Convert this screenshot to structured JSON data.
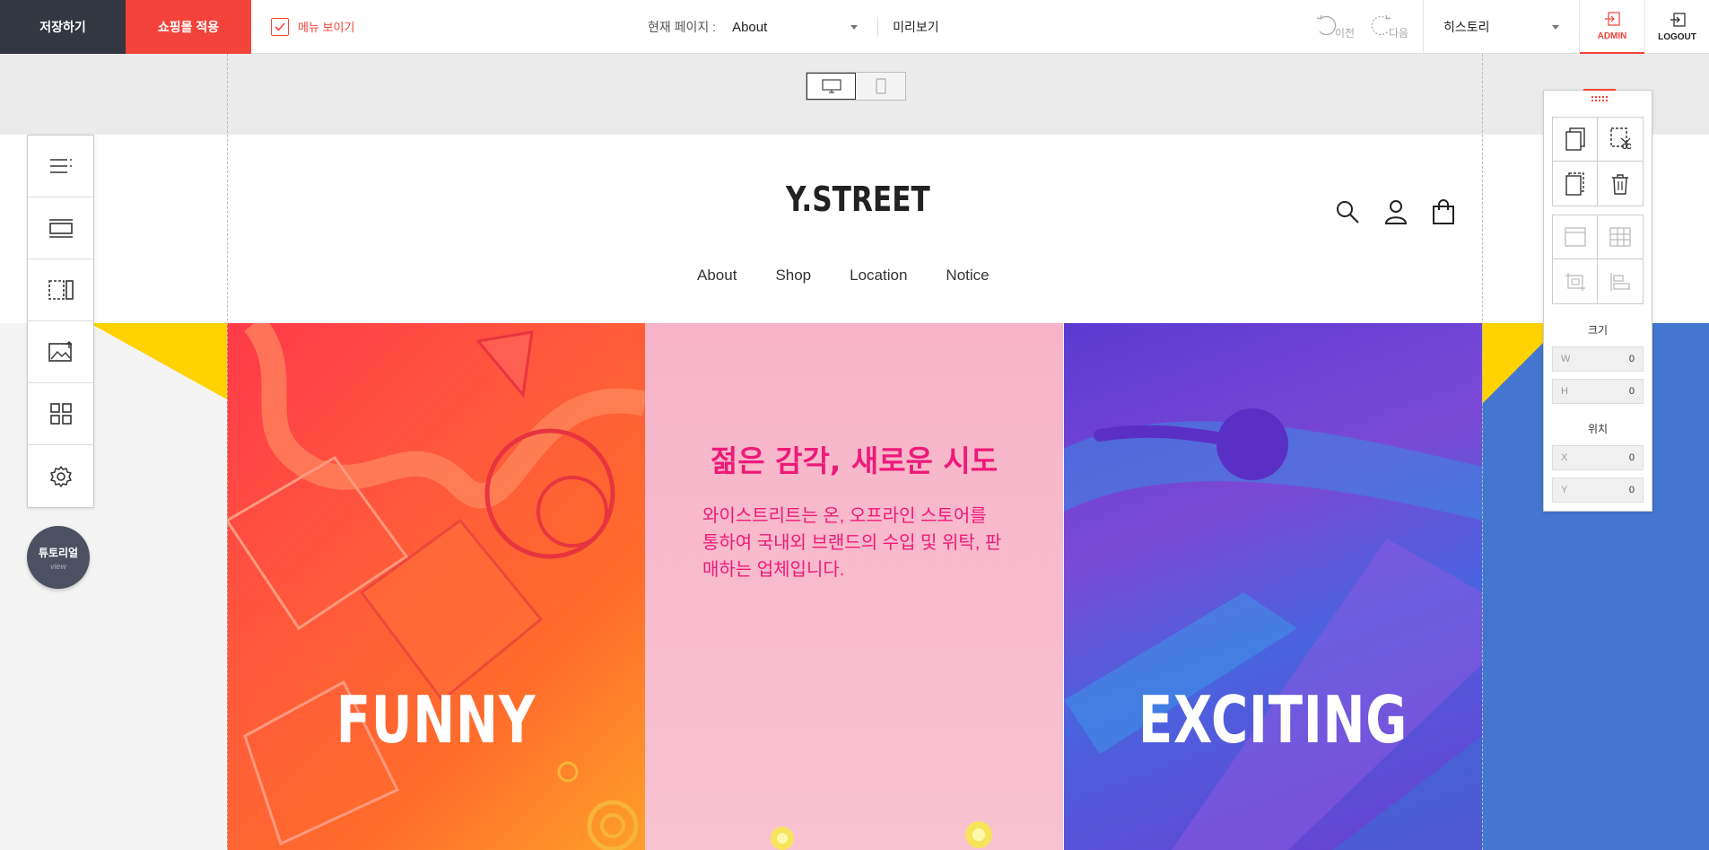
{
  "topbar": {
    "save_label": "저장하기",
    "apply_label": "쇼핑몰 적용",
    "menu_toggle_label": "메뉴 보이기",
    "current_page_label": "현재 페이지 :",
    "current_page_value": "About",
    "preview_label": "미리보기",
    "undo_label": "이전",
    "redo_label": "다음",
    "history_label": "히스토리",
    "admin_label": "ADMIN",
    "logout_label": "LOGOUT"
  },
  "device_toggle": {
    "selected": "desktop",
    "options": [
      "desktop-icon",
      "mobile-icon"
    ]
  },
  "site": {
    "logo": "Y.STREET",
    "nav": [
      "About",
      "Shop",
      "Location",
      "Notice"
    ],
    "header_icons": [
      "search-icon",
      "user-icon",
      "shopping-bag-icon"
    ]
  },
  "panels": {
    "left_word": "FUNNY",
    "mid_title": "젊은 감각, 새로운 시도",
    "mid_text": "와이스트리트는 온, 오프라인 스토어를 통하여 국내외 브랜드의 수입 및 위탁, 판매하는 업체입니다.",
    "right_word": "EXCITING"
  },
  "left_toolbar": {
    "tools": [
      "menu-list-icon",
      "section-icon",
      "split-column-icon",
      "image-upload-icon",
      "grid-icon",
      "gear-icon"
    ]
  },
  "tutorial": {
    "title": "튜토리얼",
    "sub": "view"
  },
  "right_panel": {
    "edit_tools": [
      "copy-icon",
      "cut-icon",
      "paste-icon",
      "trash-icon"
    ],
    "layout_tools": [
      "section-layout-icon",
      "table-layout-icon",
      "crop-layout-icon",
      "align-layout-icon"
    ],
    "size_label": "크기",
    "position_label": "위치",
    "fields": {
      "w": {
        "label": "W",
        "value": "0"
      },
      "h": {
        "label": "H",
        "value": "0"
      },
      "x": {
        "label": "X",
        "value": "0"
      },
      "y": {
        "label": "Y",
        "value": "0"
      }
    }
  },
  "colors": {
    "primary_dark": "#323742",
    "accent_red": "#f4433a",
    "mid_pink_text": "#ee1a7a",
    "right_blue": "#4276cf",
    "stripe_yellow": "#ffd200"
  }
}
